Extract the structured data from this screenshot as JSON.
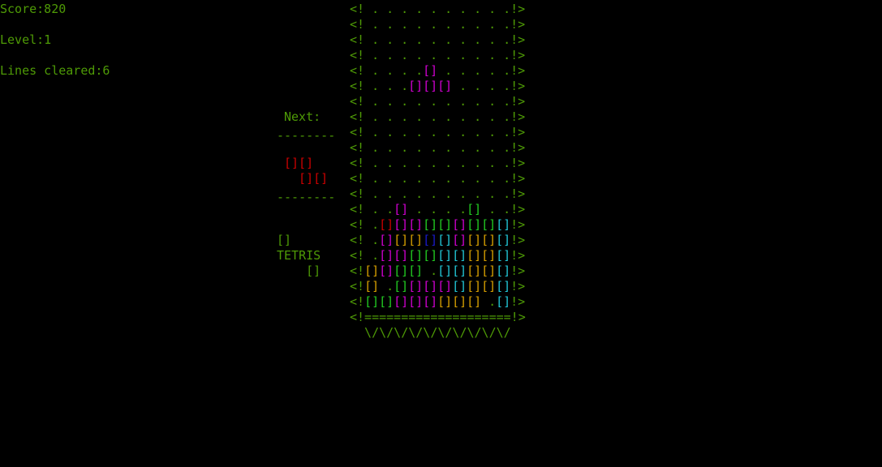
{
  "stats": {
    "score": "Score:820",
    "level": "Level:1",
    "lines": "Lines cleared:6"
  },
  "next_panel": {
    "title": "Next:",
    "divider_top": "--------",
    "divider_bottom": "--------",
    "piece_rows": [
      "[][]",
      "  [][]"
    ],
    "piece_color": "#cc0000"
  },
  "logo": {
    "top": "[]",
    "word": "TETRIS",
    "bottom": "   []"
  },
  "board": {
    "left_wall": "<!",
    "right_wall": "!>",
    "empty_glyph": " .",
    "block_glyph": "[]",
    "floor": "<!====================!>",
    "base": "\\/\\/\\/\\/\\/\\/\\/\\/\\/\\/",
    "colors": {
      "M": "#d000d0",
      "G": "#22cc22",
      "R": "#cc0000",
      "B": "#1a1acc",
      "C": "#22c8d8",
      "O": "#d8a000",
      "Y": "#e6b400"
    },
    "rows": [
      "..........",
      "..........",
      "..........",
      "..........",
      "....M.....",
      "...MMM....",
      "..........",
      "..........",
      "..........",
      "..........",
      "..........",
      "..........",
      "..........",
      "..M....G..",
      ".RMMGGMGGC",
      ".MOOBCMOOC",
      ".MMGGCCOOC",
      "OMGG.CCOOC",
      "O.GMMMCOOC",
      "GGMMMOOO.C"
    ]
  },
  "accent_color": "#4e9a06"
}
